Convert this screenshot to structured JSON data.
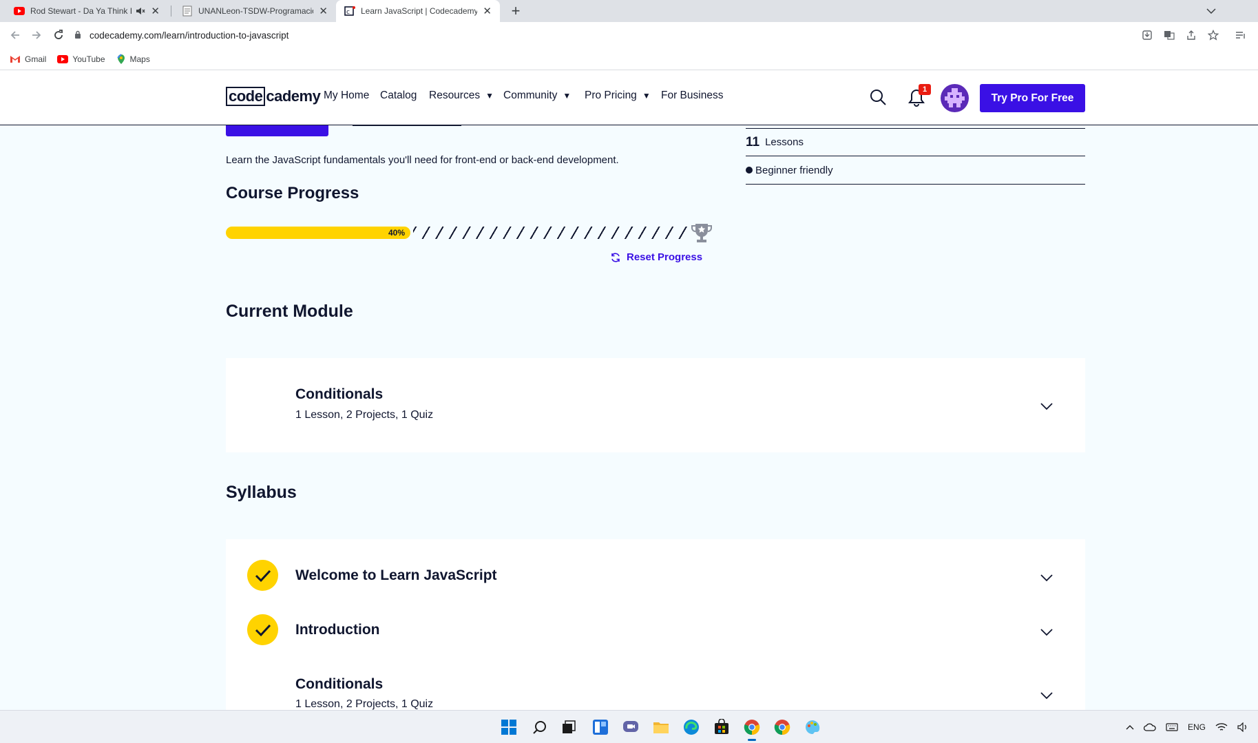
{
  "browser": {
    "tabs": [
      {
        "title": "Rod Stewart - Da Ya Think I'm Sexy",
        "favicon": "youtube-icon",
        "muted": true
      },
      {
        "title": "UNANLeon-TSDW-Programación",
        "favicon": "document-icon"
      },
      {
        "title": "Learn JavaScript | Codecademy",
        "favicon": "codecademy-icon",
        "active": true
      }
    ],
    "url": "codecademy.com/learn/introduction-to-javascript",
    "bookmarks": [
      {
        "label": "Gmail",
        "icon": "gmail-icon"
      },
      {
        "label": "YouTube",
        "icon": "youtube-icon"
      },
      {
        "label": "Maps",
        "icon": "maps-icon"
      }
    ]
  },
  "header": {
    "logo_code": "code",
    "logo_cademy": "cademy",
    "nav": [
      {
        "label": "My Home"
      },
      {
        "label": "Catalog"
      },
      {
        "label": "Resources",
        "caret": "▼"
      },
      {
        "label": "Community",
        "caret": "▼"
      },
      {
        "label": "Pro Pricing",
        "caret": "▼"
      },
      {
        "label": "For Business"
      }
    ],
    "notification_count": "1",
    "cta": "Try Pro For Free"
  },
  "course": {
    "description": "Learn the JavaScript fundamentals you'll need for front-end or back-end development.",
    "stats": {
      "lessons_count": "11",
      "lessons_label": "Lessons",
      "level": "Beginner friendly"
    },
    "progress": {
      "title": "Course Progress",
      "percent": 40,
      "percent_label": "40%",
      "reset_label": "Reset Progress"
    },
    "current_module": {
      "title": "Current Module",
      "name": "Conditionals",
      "meta": "1 Lesson, 2 Projects, 1 Quiz"
    },
    "syllabus": {
      "title": "Syllabus",
      "items": [
        {
          "name": "Welcome to Learn JavaScript",
          "completed": true
        },
        {
          "name": "Introduction",
          "completed": true
        },
        {
          "name": "Conditionals",
          "meta": "1 Lesson, 2 Projects, 1 Quiz",
          "completed": false
        }
      ]
    }
  },
  "taskbar": {
    "apps": [
      "windows-start-icon",
      "search-icon",
      "task-view-icon",
      "widgets-icon",
      "chat-icon",
      "file-explorer-icon",
      "edge-icon",
      "store-icon",
      "chrome-icon",
      "chrome-icon",
      "paint-icon"
    ],
    "tray_language": "ENG"
  },
  "colors": {
    "brand_blue": "#3a10e5",
    "progress_yellow": "#ffd300",
    "navy": "#10162f",
    "page_bg": "#f5fcff"
  }
}
